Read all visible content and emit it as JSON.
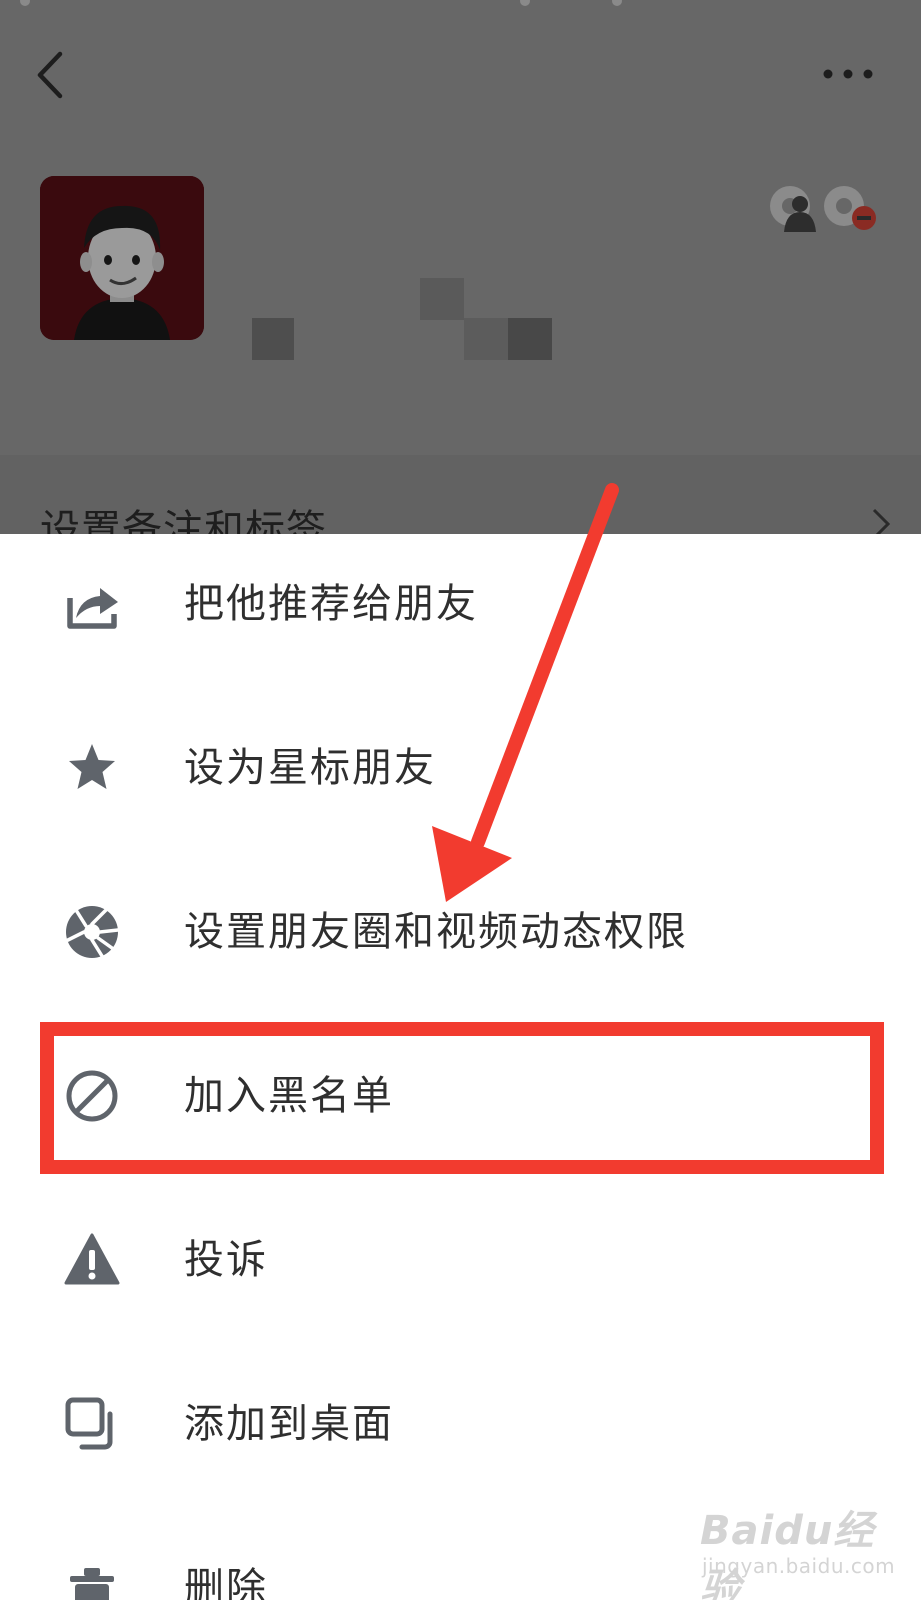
{
  "profile_header": {
    "remark_row_label": "设置备注和标签"
  },
  "menu": {
    "items": [
      {
        "id": "recommend",
        "label": "把他推荐给朋友",
        "icon": "share-icon"
      },
      {
        "id": "star",
        "label": "设为星标朋友",
        "icon": "star-icon"
      },
      {
        "id": "moments",
        "label": "设置朋友圈和视频动态权限",
        "icon": "aperture-icon"
      },
      {
        "id": "blacklist",
        "label": "加入黑名单",
        "icon": "block-icon"
      },
      {
        "id": "report",
        "label": "投诉",
        "icon": "warning-icon"
      },
      {
        "id": "desktop",
        "label": "添加到桌面",
        "icon": "add-to-desktop-icon"
      },
      {
        "id": "delete",
        "label": "删除",
        "icon": "trash-icon"
      }
    ]
  },
  "annotation": {
    "highlighted_item": "加入黑名单",
    "color": "#f23b2f"
  },
  "watermark": {
    "brand": "Baidu经验",
    "url": "jingyan.baidu.com"
  },
  "colors": {
    "overlay": "#676767",
    "icon": "#5f646b",
    "text": "#2f2f2f",
    "sheet_bg": "#ffffff"
  }
}
